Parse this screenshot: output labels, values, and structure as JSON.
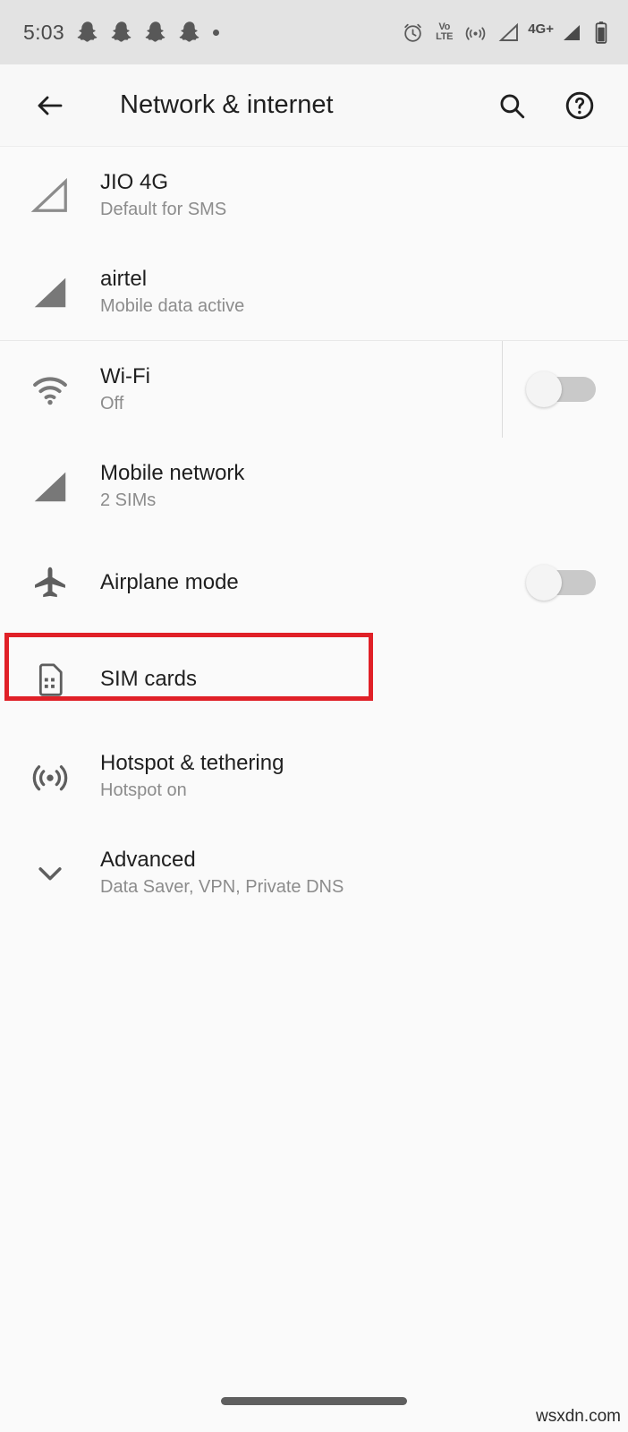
{
  "statusbar": {
    "time": "5:03",
    "notification_icons": [
      "snapchat-ghost-icon",
      "snapchat-ghost-icon",
      "snapchat-ghost-icon",
      "snapchat-ghost-icon",
      "overflow-dot-icon"
    ],
    "alarm_icon": "alarm-clock-icon",
    "volte_line1": "Vo",
    "volte_line2": "LTE",
    "hotspot_icon": "hotspot-icon",
    "signal1_icon": "signal-empty-icon",
    "network_type": "4G+",
    "signal2_icon": "signal-full-icon",
    "battery_icon": "battery-icon",
    "bg_color": "#e3e3e3"
  },
  "appbar": {
    "back_icon": "arrow-back-icon",
    "title": "Network & internet",
    "search_icon": "search-icon",
    "help_icon": "help-circle-icon"
  },
  "sim_section": [
    {
      "icon": "signal-empty-icon",
      "title": "JIO 4G",
      "subtitle": "Default for SMS"
    },
    {
      "icon": "signal-full-icon",
      "title": "airtel",
      "subtitle": "Mobile data active"
    }
  ],
  "settings": [
    {
      "icon": "wifi-icon",
      "title": "Wi-Fi",
      "subtitle": "Off",
      "toggle": "off",
      "toggle_divider": true
    },
    {
      "icon": "signal-full-icon",
      "title": "Mobile network",
      "subtitle": "2 SIMs",
      "toggle": null
    },
    {
      "icon": "airplane-icon",
      "title": "Airplane mode",
      "subtitle": "",
      "toggle": "off",
      "toggle_divider": false
    },
    {
      "icon": "sim-card-icon",
      "title": "SIM cards",
      "subtitle": "",
      "toggle": null,
      "highlighted": true
    },
    {
      "icon": "hotspot-icon",
      "title": "Hotspot & tethering",
      "subtitle": "Hotspot on",
      "toggle": null
    },
    {
      "icon": "chevron-down-icon",
      "title": "Advanced",
      "subtitle": "Data Saver, VPN, Private DNS",
      "toggle": null
    }
  ],
  "navigation": {
    "pill": "home-gesture-pill"
  },
  "watermark": "wsxdn.com",
  "colors": {
    "highlight": "#e02027",
    "title_text": "#1f1f1f",
    "subtitle_text": "#8c8c8c",
    "page_bg": "#fafafa",
    "statusbar_bg": "#e3e3e3",
    "appbar_bg": "#f8f8f8"
  }
}
